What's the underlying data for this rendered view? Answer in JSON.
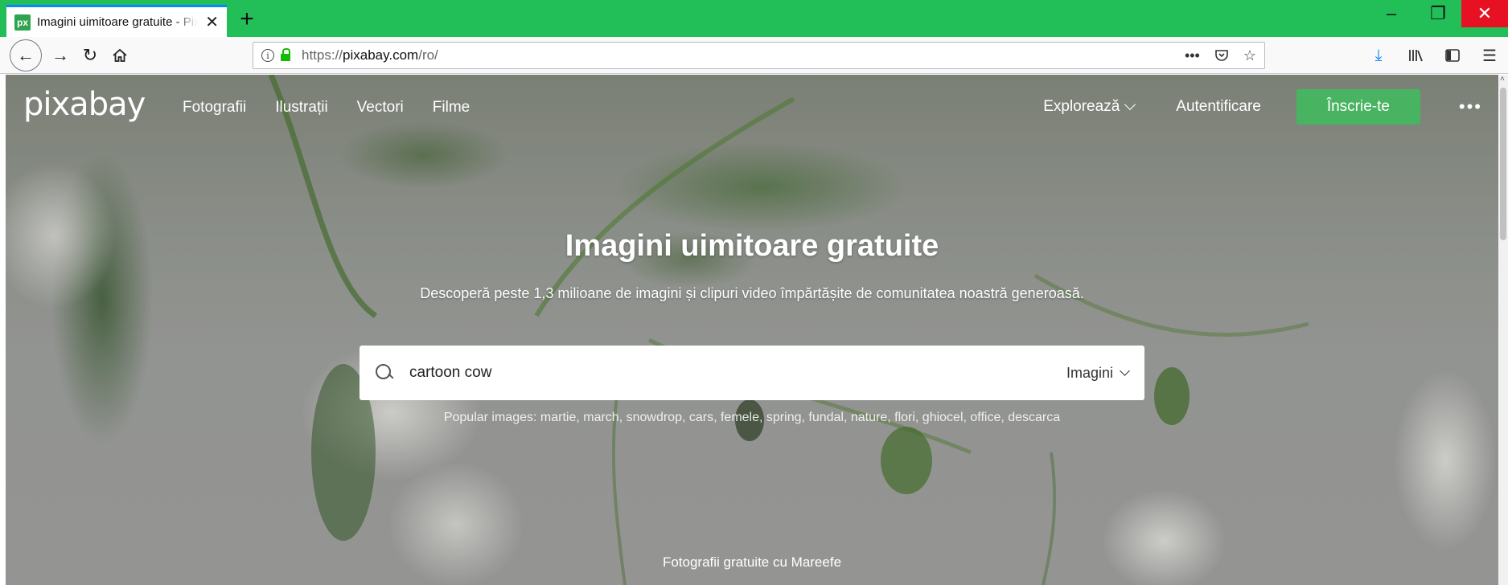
{
  "browser": {
    "tab": {
      "favicon": "px",
      "title": "Imagini uimitoare gratuite - Pixabay"
    },
    "window_controls": {
      "minimize": "–",
      "restore": "❐",
      "close": "✕"
    },
    "url": {
      "scheme": "https://",
      "host": "pixabay.com",
      "path": "/ro/"
    },
    "icons": [
      "back-icon",
      "forward-icon",
      "reload-icon",
      "home-icon",
      "info-icon",
      "lock-icon",
      "page-actions-icon",
      "pocket-icon",
      "bookmark-star-icon",
      "download-icon",
      "library-icon",
      "sidebar-icon",
      "menu-icon"
    ]
  },
  "site": {
    "logo": "pixabay",
    "nav": {
      "photos": "Fotografii",
      "illustrations": "Ilustrații",
      "vectors": "Vectori",
      "videos": "Filme"
    },
    "right_nav": {
      "explore": "Explorează",
      "login": "Autentificare",
      "signup": "Înscrie-te",
      "more": "•••"
    },
    "hero": {
      "title": "Imagini uimitoare gratuite",
      "subtitle": "Descoperă peste 1,3 milioane de imagini și clipuri video împărtășite de comunitatea noastră generoasă."
    },
    "search": {
      "value": "cartoon cow",
      "type": "Imagini"
    },
    "popular": {
      "prefix": "Popular images:",
      "terms": [
        "martie",
        "march",
        "snowdrop",
        "cars",
        "femele",
        "spring",
        "fundal",
        "nature",
        "flori",
        "ghiocel",
        "office",
        "descarca"
      ]
    },
    "credit": {
      "prefix": "Fotografii gratuite cu",
      "author": "Mareefe"
    }
  },
  "colors": {
    "tabstrip": "#22bf58",
    "signup": "#48b461",
    "download": "#0a84ff",
    "close": "#e81123"
  }
}
